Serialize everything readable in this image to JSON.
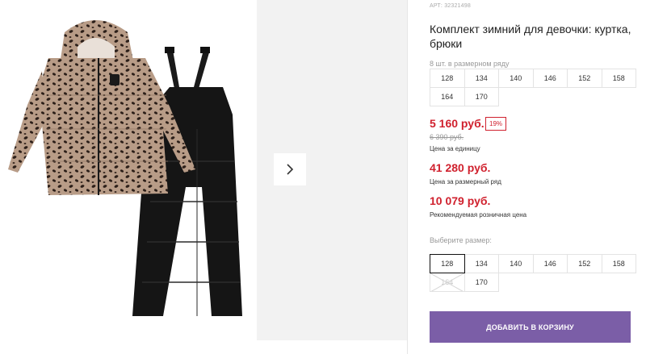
{
  "product": {
    "article": "АРТ: 32321498",
    "title": "Комплект зимний для девочки: куртка, брюки"
  },
  "size_row": {
    "label": "8 шт. в размерном ряду",
    "sizes": [
      "128",
      "134",
      "140",
      "146",
      "152",
      "158",
      "164",
      "170"
    ]
  },
  "prices": {
    "unit_price": "5 160 руб.",
    "discount": "19%",
    "old_price": "6 390 руб.",
    "unit_note": "Цена за единицу",
    "row_price": "41 280 руб.",
    "row_note": "Цена за размерный ряд",
    "rrp_price": "10 079 руб.",
    "rrp_note": "Рекомендуемая розничная цена"
  },
  "size_select": {
    "prompt": "Выберите размер:",
    "options": [
      "128",
      "134",
      "140",
      "146",
      "152",
      "158",
      "164",
      "170"
    ],
    "selected": "128",
    "disabled": [
      "164"
    ]
  },
  "actions": {
    "add_to_cart": "ДОБАВИТЬ В КОРЗИНУ"
  },
  "colors": {
    "price_red": "#d0212e",
    "button_purple": "#7b5ea7",
    "secondary_bg": "#f2f2f2"
  },
  "icons": {
    "gallery_next": "chevron-right-icon"
  }
}
